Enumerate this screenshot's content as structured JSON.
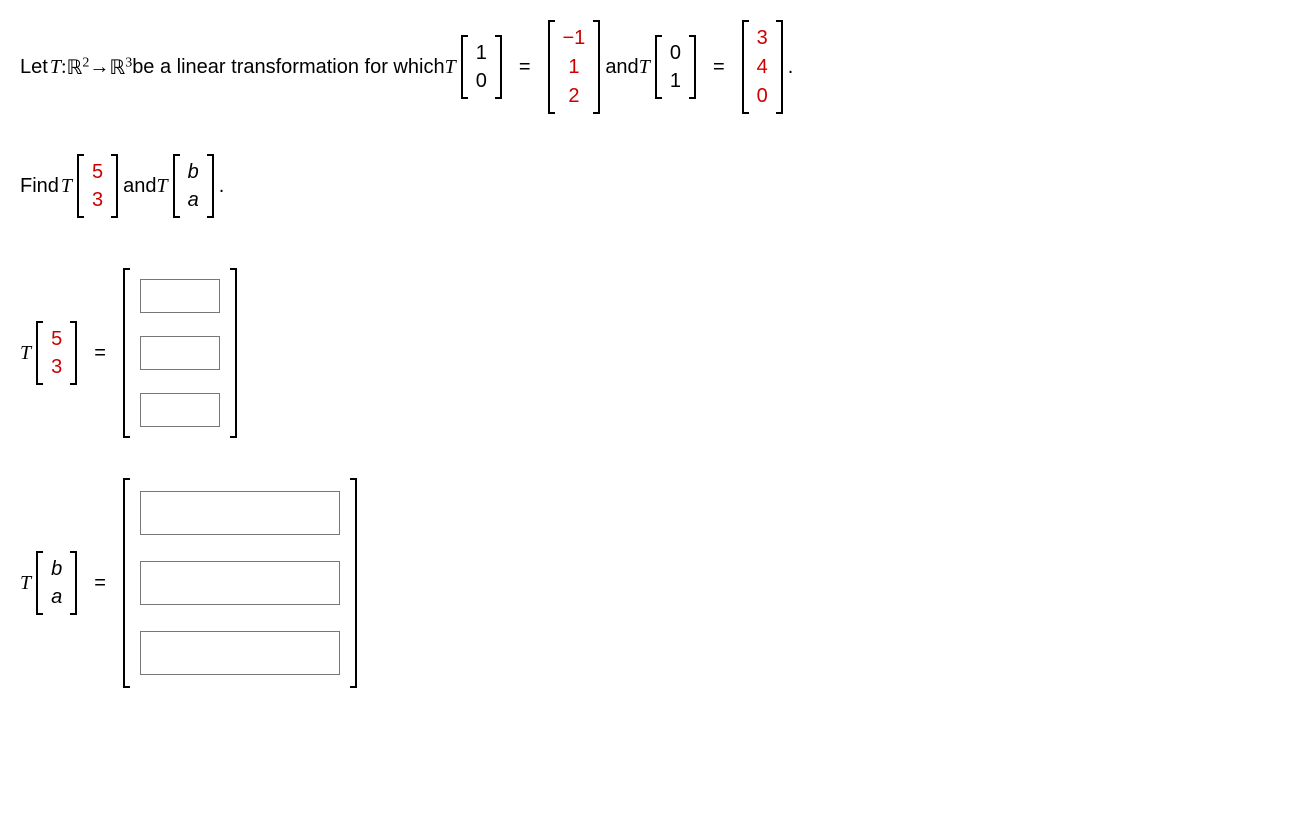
{
  "line1": {
    "pre": "Let ",
    "T": "T",
    "colon": " : ",
    "R": "ℝ",
    "sup2": "2",
    "arrow": " → ",
    "sup3": "3",
    "mid": " be a linear transformation for which ",
    "eq": "=",
    "and": " and ",
    "dot": ".",
    "v1": [
      "1",
      "0"
    ],
    "r1": [
      "−1",
      "1",
      "2"
    ],
    "v2": [
      "0",
      "1"
    ],
    "r2": [
      "3",
      "4",
      "0"
    ]
  },
  "line2": {
    "pre": "Find ",
    "T": "T",
    "v1": [
      "5",
      "3"
    ],
    "and": " and ",
    "v2": [
      "b",
      "a"
    ],
    "dot": "."
  },
  "ans1": {
    "T": "T",
    "v": [
      "5",
      "3"
    ],
    "eq": "="
  },
  "ans2": {
    "T": "T",
    "v": [
      "b",
      "a"
    ],
    "eq": "="
  }
}
